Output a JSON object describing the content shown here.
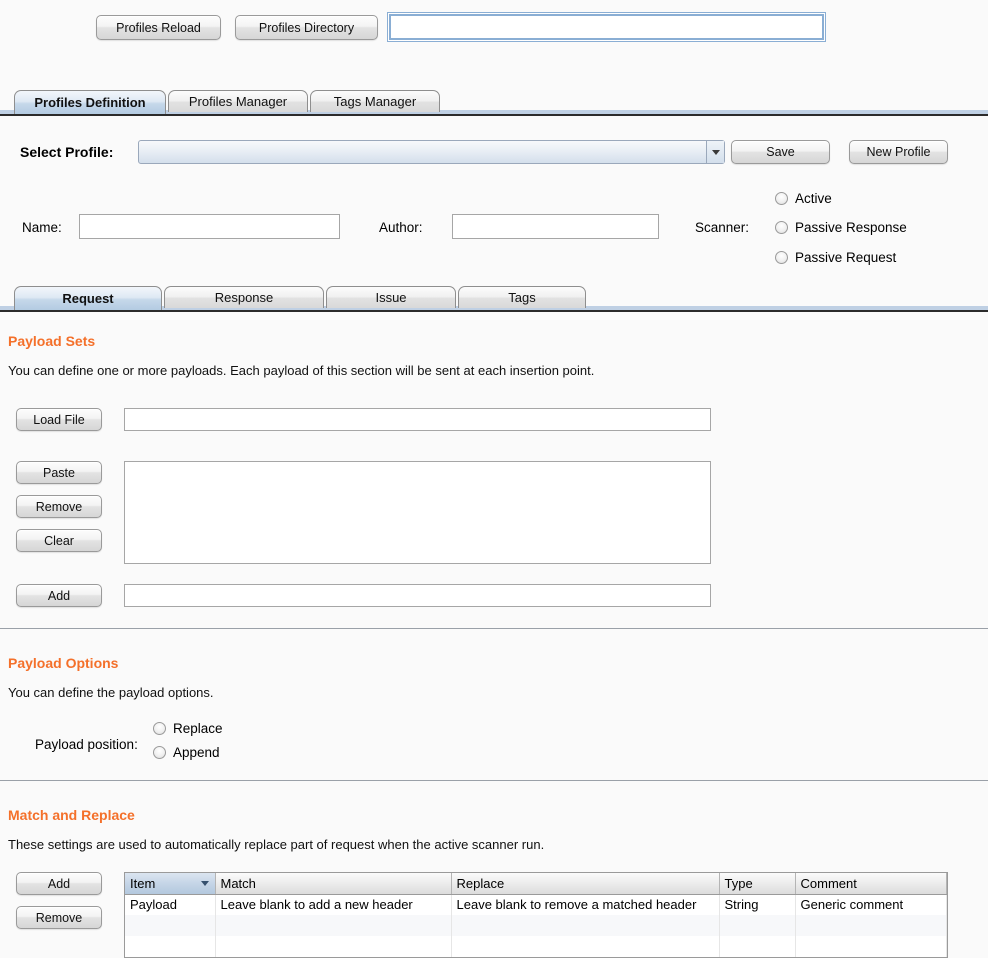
{
  "toolbar": {
    "profiles_reload_label": "Profiles Reload",
    "profiles_directory_label": "Profiles Directory",
    "path_value": "",
    "path_placeholder": ""
  },
  "outer_tabs": [
    {
      "label": "Profiles Definition",
      "active": true
    },
    {
      "label": "Profiles Manager",
      "active": false
    },
    {
      "label": "Tags Manager",
      "active": false
    }
  ],
  "profile": {
    "select_label": "Select Profile:",
    "selected_value": "",
    "save_label": "Save",
    "new_profile_label": "New Profile",
    "name_label": "Name:",
    "name_value": "",
    "author_label": "Author:",
    "author_value": "",
    "scanner_label": "Scanner:",
    "scanner_options": [
      {
        "label": "Active",
        "selected": false
      },
      {
        "label": "Passive Response",
        "selected": false
      },
      {
        "label": "Passive Request",
        "selected": false
      }
    ]
  },
  "inner_tabs": [
    {
      "label": "Request",
      "active": true
    },
    {
      "label": "Response",
      "active": false
    },
    {
      "label": "Issue",
      "active": false
    },
    {
      "label": "Tags",
      "active": false
    }
  ],
  "payload_sets": {
    "title": "Payload Sets",
    "description": "You can define one or more payloads. Each payload of this section will be sent at each insertion point.",
    "load_file_label": "Load File",
    "load_file_value": "",
    "paste_label": "Paste",
    "remove_label": "Remove",
    "clear_label": "Clear",
    "payload_list_value": "",
    "add_label": "Add",
    "add_value": ""
  },
  "payload_options": {
    "title": "Payload Options",
    "description": "You can define the payload options.",
    "position_label": "Payload position:",
    "position_options": [
      {
        "label": "Replace",
        "selected": false
      },
      {
        "label": "Append",
        "selected": false
      }
    ]
  },
  "match_replace": {
    "title": "Match and Replace",
    "description": "These settings are used to automatically replace part of request when the active scanner run.",
    "add_label": "Add",
    "remove_label": "Remove",
    "columns": [
      "Item",
      "Match",
      "Replace",
      "Type",
      "Comment"
    ],
    "sorted_column": "Item",
    "rows": [
      {
        "item": "Payload",
        "match": "Leave blank to add a new header",
        "replace": "Leave blank to remove a matched header",
        "type": "String",
        "comment": "Generic comment"
      }
    ]
  },
  "colors": {
    "section_heading": "#f4702a",
    "active_tab": "#b3cbe2",
    "sorted_header": "#b3c8de",
    "page_background": "#fafafa"
  }
}
